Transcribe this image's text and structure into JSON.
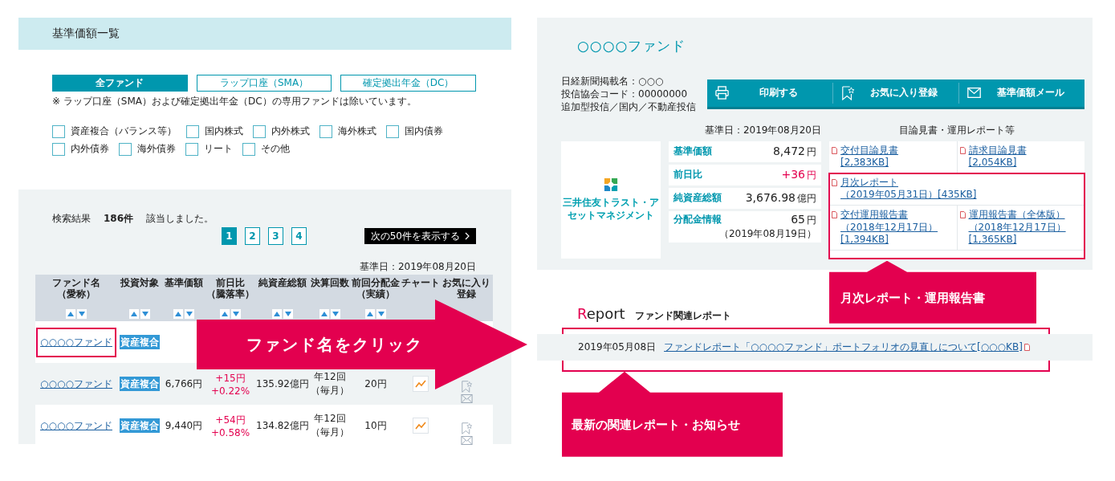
{
  "left": {
    "heading": "基準価額一覧",
    "tabs": [
      {
        "label": "全ファンド",
        "selected": true
      },
      {
        "label": "ラップ口座（SMA）",
        "selected": false
      },
      {
        "label": "確定拠出年金（DC）",
        "selected": false
      }
    ],
    "tab_note": "※ ラップ口座（SMA）および確定拠出年金（DC）の専用ファンドは除いています。",
    "filters": [
      {
        "label": "資産複合（バランス等）",
        "checked": false
      },
      {
        "label": "国内株式",
        "checked": false
      },
      {
        "label": "内外株式",
        "checked": false
      },
      {
        "label": "海外株式",
        "checked": false
      },
      {
        "label": "国内債券",
        "checked": false
      },
      {
        "label": "内外債券",
        "checked": false
      },
      {
        "label": "海外債券",
        "checked": false
      },
      {
        "label": "リート",
        "checked": false
      },
      {
        "label": "その他",
        "checked": false
      }
    ],
    "results": "検索結果　**186件**　該当しました。",
    "pages": [
      {
        "label": "1",
        "selected": true
      },
      {
        "label": "2",
        "selected": false
      },
      {
        "label": "3",
        "selected": false
      },
      {
        "label": "4",
        "selected": false
      }
    ],
    "next_button": "次の50件を表示する",
    "as_of": "基準日：2019年08月20日",
    "columns": [
      {
        "lines": [
          "ファンド名",
          "（愛称）"
        ],
        "sortable": true
      },
      {
        "lines": [
          "投資対象"
        ],
        "sortable": true
      },
      {
        "lines": [
          "基準価額"
        ],
        "sortable": true
      },
      {
        "lines": [
          "前日比",
          "（騰落率）"
        ],
        "sortable": true
      },
      {
        "lines": [
          "純資産総額"
        ],
        "sortable": true
      },
      {
        "lines": [
          "決算回数"
        ],
        "sortable": true
      },
      {
        "lines": [
          "前回分配金",
          "（実績）"
        ],
        "sortable": true
      },
      {
        "lines": [
          "チャート"
        ],
        "sortable": false
      },
      {
        "lines": [
          "お気に入り",
          "登録"
        ],
        "sortable": false
      }
    ],
    "rows": [
      {
        "name": "○○○○ファンド",
        "asset": "資産複合",
        "highlighted": true
      },
      {
        "name": "○○○○ファンド",
        "asset": "資産複合",
        "highlighted": false,
        "price": "6,766円",
        "change": "+15円",
        "rate": "+0.22%",
        "net_assets": "135.92億円",
        "frequency": "年12回（毎月）",
        "dividend": "20円",
        "chart": true,
        "favorite": true
      },
      {
        "name": "○○○○ファンド",
        "asset": "資産複合",
        "highlighted": false,
        "price": "9,440円",
        "change": "+54円",
        "rate": "+0.58%",
        "net_assets": "134.82億円",
        "frequency": "年12回（毎月）",
        "dividend": "10円",
        "chart": true,
        "favorite": true
      }
    ]
  },
  "arrow_label": "ファンド名をクリック",
  "right": {
    "title": "○○○○ファンド",
    "info": [
      "日経新聞掲載名：○○○",
      "投信協会コード：00000000",
      "追加型投信／国内／不動産投信"
    ],
    "actions": [
      {
        "kind": "print",
        "label": "印刷する"
      },
      {
        "kind": "favorite",
        "label": "お気に入り登録"
      },
      {
        "kind": "mail",
        "label": "基準価額メール"
      }
    ],
    "as_of": "基準日：2019年08月20日",
    "docs_heading": "目論見書・運用レポート等",
    "logo": "三井住友トラスト・アセットマネジメント",
    "prices": [
      {
        "label": "基準価額",
        "value": "8,472",
        "unit": "円",
        "kind": "amount"
      },
      {
        "label": "前日比",
        "value": "+36",
        "unit": "円",
        "kind": "change"
      },
      {
        "label": "純資産総額",
        "value": "3,676.98",
        "unit": "億円",
        "kind": "amount"
      },
      {
        "label": "分配金情報",
        "value": "65",
        "unit": "円",
        "kind": "amount",
        "note": "（2019年08月19日）"
      }
    ],
    "docs_top": [
      {
        "title": "交付目論見書",
        "meta": "[2,383KB]"
      },
      {
        "title": "請求目論見書",
        "meta": "[2,054KB]"
      }
    ],
    "docs_highlighted": [
      [
        {
          "title": "月次レポート",
          "meta": "（2019年05月31日）[435KB]"
        }
      ],
      [
        {
          "title": "交付運用報告書",
          "meta": "（2018年12月17日）[1,394KB]"
        },
        {
          "title": "運用報告書（全体版）",
          "meta": "（2018年12月17日）[1,365KB]"
        }
      ]
    ],
    "docs_callout": "月次レポート・運用報告書",
    "report": {
      "title": "Report",
      "subtitle": "ファンド関連レポート",
      "items": [
        {
          "date": "2019年05月08日",
          "link": "ファンドレポート「○○○○ファンド」ポートフォリオの見直しについて[○○○KB]"
        }
      ]
    },
    "report_callout": "最新の関連レポート・お知らせ"
  }
}
